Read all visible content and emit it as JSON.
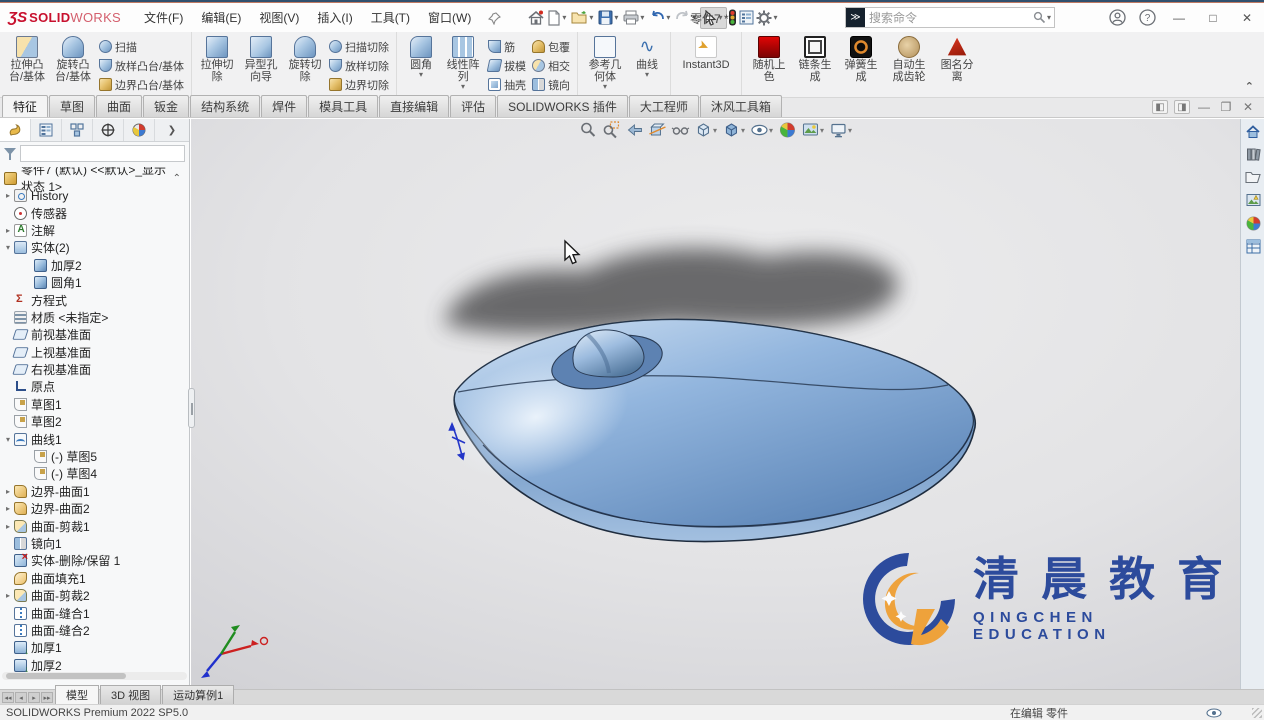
{
  "window": {
    "logo_prefix": "ƷS",
    "logo_solid": "SOLID",
    "logo_works": "WORKS",
    "doc_title": "零件7 *",
    "controls": [
      "minimize",
      "maximize",
      "close"
    ]
  },
  "menus": [
    {
      "label": "文件(F)"
    },
    {
      "label": "编辑(E)"
    },
    {
      "label": "视图(V)"
    },
    {
      "label": "插入(I)"
    },
    {
      "label": "工具(T)"
    },
    {
      "label": "窗口(W)"
    }
  ],
  "quick_toolbar_icons": [
    "home",
    "new-document",
    "open",
    "save",
    "print",
    "undo",
    "redo",
    "select-arrow",
    "rebuild-traffic-light",
    "task-list",
    "options-gear"
  ],
  "search": {
    "placeholder": "搜索命令"
  },
  "ribbon": {
    "g1": {
      "b1": "拉伸凸\n台/基体",
      "b2": "旋转凸\n台/基体",
      "s1": "扫描",
      "s2": "放样凸台/基体",
      "s3": "边界凸台/基体"
    },
    "g2": {
      "b1": "拉伸切\n除",
      "b2": "异型孔\n向导",
      "b3": "旋转切\n除",
      "s1": "扫描切除",
      "s2": "放样切除",
      "s3": "边界切除"
    },
    "g3": {
      "b1": "圆角",
      "b2": "线性阵\n列",
      "s1": "筋",
      "s2": "拔模",
      "s3": "抽壳",
      "s4": "包覆",
      "s5": "相交",
      "s6": "镜向"
    },
    "g4": {
      "b1": "参考几\n何体",
      "b2": "曲线"
    },
    "g5": {
      "b1": "Instant3D"
    },
    "g6": {
      "b1": "随机上\n色",
      "b2": "链条生\n成",
      "b3": "弹簧生\n成",
      "b4": "自动生\n成齿轮",
      "b5": "图名分\n离"
    }
  },
  "doc_tabs": [
    {
      "label": "特征",
      "cls": "active"
    },
    {
      "label": "草图",
      "cls": ""
    },
    {
      "label": "曲面",
      "cls": ""
    },
    {
      "label": "钣金",
      "cls": ""
    },
    {
      "label": "结构系统",
      "cls": ""
    },
    {
      "label": "焊件",
      "cls": ""
    },
    {
      "label": "模具工具",
      "cls": ""
    },
    {
      "label": "直接编辑",
      "cls": ""
    },
    {
      "label": "评估",
      "cls": ""
    },
    {
      "label": "SOLIDWORKS 插件",
      "cls": ""
    },
    {
      "label": "大工程师",
      "cls": ""
    },
    {
      "label": "沐风工具箱",
      "cls": ""
    }
  ],
  "panel": {
    "root_label": "零件7 (默认) <<默认>_显示状态 1>",
    "tab_icons": [
      "featuremanager-tree",
      "propertymanager",
      "configurationmanager",
      "dimxpertmanager",
      "displaymanager"
    ]
  },
  "tree": [
    {
      "label": "History",
      "icon": "ic-history",
      "arrow": "arr-r",
      "pad": "2px"
    },
    {
      "label": "传感器",
      "icon": "ic-sensor",
      "arrow": "arr-0",
      "pad": "2px"
    },
    {
      "label": "注解",
      "icon": "ic-ann",
      "arrow": "arr-r",
      "pad": "2px"
    },
    {
      "label": "实体(2)",
      "icon": "ic-solids",
      "arrow": "arr-d",
      "pad": "2px"
    },
    {
      "label": "加厚2",
      "icon": "ic-solid",
      "arrow": "arr-0",
      "pad": "22px"
    },
    {
      "label": "圆角1",
      "icon": "ic-solid",
      "arrow": "arr-0",
      "pad": "22px"
    },
    {
      "label": "方程式",
      "icon": "ic-eq",
      "arrow": "arr-0",
      "pad": "2px"
    },
    {
      "label": "材质 <未指定>",
      "icon": "ic-mat",
      "arrow": "arr-0",
      "pad": "2px"
    },
    {
      "label": "前视基准面",
      "icon": "ic-plane",
      "arrow": "arr-0",
      "pad": "2px"
    },
    {
      "label": "上视基准面",
      "icon": "ic-plane",
      "arrow": "arr-0",
      "pad": "2px"
    },
    {
      "label": "右视基准面",
      "icon": "ic-plane",
      "arrow": "arr-0",
      "pad": "2px"
    },
    {
      "label": "原点",
      "icon": "ic-origin",
      "arrow": "arr-0",
      "pad": "2px"
    },
    {
      "label": "草图1",
      "icon": "ic-sketch",
      "arrow": "arr-0",
      "pad": "2px"
    },
    {
      "label": "草图2",
      "icon": "ic-sketch",
      "arrow": "arr-0",
      "pad": "2px"
    },
    {
      "label": "曲线1",
      "icon": "ic-curve",
      "arrow": "arr-d",
      "pad": "2px"
    },
    {
      "label": "(-) 草图5",
      "icon": "ic-sketch",
      "arrow": "arr-0",
      "pad": "22px"
    },
    {
      "label": "(-) 草图4",
      "icon": "ic-sketch",
      "arrow": "arr-0",
      "pad": "22px"
    },
    {
      "label": "边界-曲面1",
      "icon": "ic-surface",
      "arrow": "arr-r",
      "pad": "2px"
    },
    {
      "label": "边界-曲面2",
      "icon": "ic-surface",
      "arrow": "arr-r",
      "pad": "2px"
    },
    {
      "label": "曲面-剪裁1",
      "icon": "ic-trim",
      "arrow": "arr-r",
      "pad": "2px"
    },
    {
      "label": "镜向1",
      "icon": "ic-mirror",
      "arrow": "arr-0",
      "pad": "2px"
    },
    {
      "label": "实体-删除/保留 1",
      "icon": "ic-delete",
      "arrow": "arr-0",
      "pad": "2px"
    },
    {
      "label": "曲面填充1",
      "icon": "ic-fill",
      "arrow": "arr-0",
      "pad": "2px"
    },
    {
      "label": "曲面-剪裁2",
      "icon": "ic-trim",
      "arrow": "arr-r",
      "pad": "2px"
    },
    {
      "label": "曲面-缝合1",
      "icon": "ic-knit",
      "arrow": "arr-0",
      "pad": "2px"
    },
    {
      "label": "曲面-缝合2",
      "icon": "ic-knit",
      "arrow": "arr-0",
      "pad": "2px"
    },
    {
      "label": "加厚1",
      "icon": "ic-thicken",
      "arrow": "arr-0",
      "pad": "2px"
    },
    {
      "label": "加厚2",
      "icon": "ic-thicken",
      "arrow": "arr-0",
      "pad": "2px"
    }
  ],
  "headsup_icons": [
    "zoom-to-fit",
    "zoom-to-area",
    "previous-view",
    "section-view",
    "annotation-view",
    "view-orientation",
    "display-style",
    "hide-show-items",
    "edit-appearance",
    "apply-scene",
    "view-settings"
  ],
  "taskpane_icons": [
    "solidworks-resources",
    "design-library",
    "file-explorer",
    "view-palette",
    "appearances-scenes",
    "custom-properties"
  ],
  "viewport": {
    "watermark_cn": "清晨教育",
    "watermark_en": "QINGCHEN EDUCATION",
    "model_color": "#7fa8d4",
    "watermark_blue": "#1e3f97",
    "watermark_orange": "#f09d2e"
  },
  "bottom_tabs": [
    {
      "label": "模型",
      "cls": "active"
    },
    {
      "label": "3D 视图",
      "cls": ""
    },
    {
      "label": "运动算例1",
      "cls": ""
    }
  ],
  "status": {
    "left": "SOLIDWORKS Premium 2022 SP5.0",
    "right": "在编辑 零件"
  }
}
